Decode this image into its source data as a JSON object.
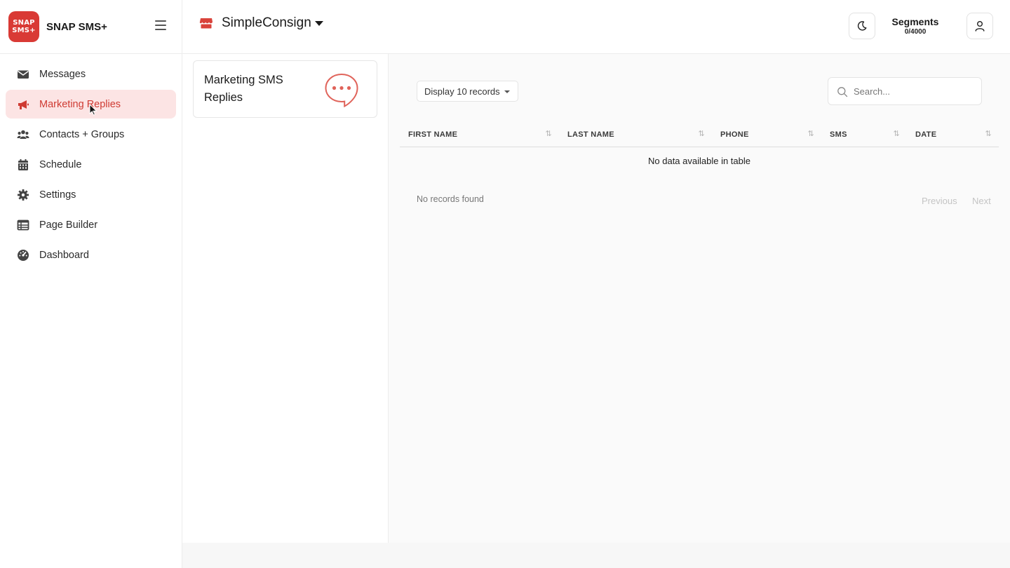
{
  "brand": {
    "logo_line1": "SNAP",
    "logo_line2": "SMS+",
    "name": "SNAP SMS+",
    "accent": "#d93a35"
  },
  "sidebar": {
    "items": [
      {
        "label": "Messages",
        "icon": "envelope-icon"
      },
      {
        "label": "Marketing Replies",
        "icon": "megaphone-icon",
        "active": true
      },
      {
        "label": "Contacts + Groups",
        "icon": "users-icon"
      },
      {
        "label": "Schedule",
        "icon": "calendar-icon"
      },
      {
        "label": "Settings",
        "icon": "gear-icon"
      },
      {
        "label": "Page Builder",
        "icon": "table-icon"
      },
      {
        "label": "Dashboard",
        "icon": "gauge-icon"
      }
    ]
  },
  "topbar": {
    "store_name": "SimpleConsign",
    "segments_label": "Segments",
    "segments_value": "0/4000"
  },
  "card": {
    "title": "Marketing SMS Replies",
    "icon": "chat-bubble-icon"
  },
  "table": {
    "length_label": "Display 10 records",
    "search_placeholder": "Search...",
    "columns": [
      "FIRST NAME",
      "LAST NAME",
      "PHONE",
      "SMS",
      "DATE"
    ],
    "empty_message": "No data available in table",
    "info": "No records found",
    "prev_label": "Previous",
    "next_label": "Next"
  }
}
